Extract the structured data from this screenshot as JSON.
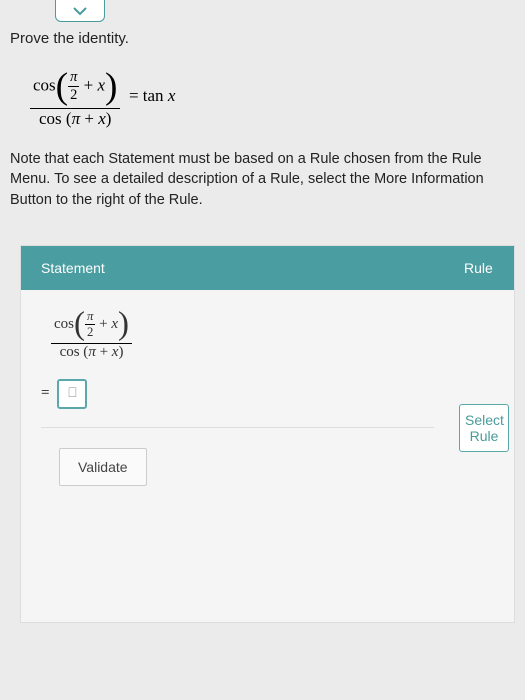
{
  "dropdown": {
    "expanded": false
  },
  "prompt": {
    "title": "Prove the identity.",
    "identity_numerator": "cos(π/2 + x)",
    "identity_denominator": "cos(π + x)",
    "identity_rhs": "tan x",
    "note": "Note that each Statement must be based on a Rule chosen from the Rule Menu. To see a detailed description of a Rule, select the More Information Button to the right of the Rule."
  },
  "table": {
    "headers": {
      "statement": "Statement",
      "rule": "Rule"
    },
    "rows": [
      {
        "expression_num": "cos(π/2 + x)",
        "expression_den": "cos(π + x)"
      }
    ],
    "input_placeholder": "▯",
    "equals": "=",
    "select_label": "Select Rule",
    "validate_label": "Validate"
  },
  "chart_data": {
    "type": "table",
    "title": "Proof steps",
    "columns": [
      "Statement",
      "Rule"
    ],
    "rows": [
      [
        "cos(π/2 + x) / cos(π + x)",
        ""
      ],
      [
        "= [input]",
        "Select Rule"
      ]
    ]
  }
}
